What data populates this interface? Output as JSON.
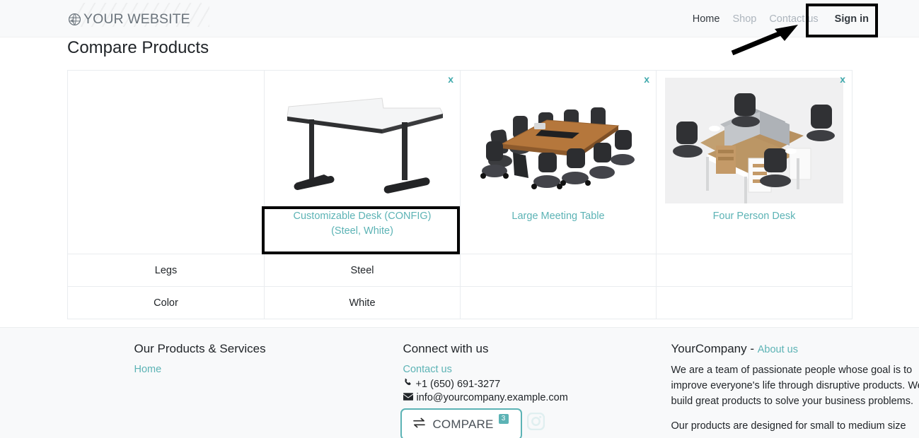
{
  "header": {
    "brand": "YOUR WEBSITE",
    "brand_icon": "globe-icon",
    "nav": [
      {
        "label": "Home",
        "active": true
      },
      {
        "label": "Shop",
        "active": false
      },
      {
        "label": "Contact us",
        "active": false
      }
    ],
    "signin_label": "Sign in"
  },
  "page": {
    "title": "Compare Products"
  },
  "compare": {
    "close_label": "x",
    "products": [
      {
        "name": "Customizable Desk (CONFIG) (Steel, White)",
        "image": "white-corner-desk-black-legs",
        "highlighted": true
      },
      {
        "name": "Large Meeting Table",
        "image": "wood-conference-table-with-chairs",
        "highlighted": false
      },
      {
        "name": "Four Person Desk",
        "image": "four-person-cubicle-workstation",
        "highlighted": false
      }
    ],
    "attributes": [
      {
        "name": "Legs",
        "values": [
          "Steel",
          "",
          ""
        ]
      },
      {
        "name": "Color",
        "values": [
          "White",
          "",
          ""
        ]
      }
    ]
  },
  "footer": {
    "col1": {
      "title": "Our Products & Services",
      "links": [
        "Home"
      ]
    },
    "col2": {
      "title": "Connect with us",
      "contact_link": "Contact us",
      "phone": "+1 (650) 691-3277",
      "email": "info@yourcompany.example.com",
      "phone_icon": "phone-icon",
      "email_icon": "envelope-icon",
      "social": [
        {
          "name": "facebook-icon",
          "faded": false
        },
        {
          "name": "twitter-icon",
          "faded": false
        },
        {
          "name": "linkedin-icon",
          "faded": false
        },
        {
          "name": "youtube-icon",
          "faded": true
        },
        {
          "name": "github-icon",
          "faded": true
        },
        {
          "name": "instagram-icon",
          "faded": true
        }
      ]
    },
    "col3": {
      "company": "YourCompany",
      "dash": "-",
      "about_link": "About us",
      "paragraph1": "We are a team of passionate people whose goal is to improve everyone's life through disruptive products. We build great products to solve your business problems.",
      "paragraph2": "Our products are designed for small to medium size"
    }
  },
  "compare_widget": {
    "icon": "compare-arrows-icon",
    "label": "COMPARE",
    "count": "3"
  },
  "colors": {
    "accent_teal": "#5cb3b5",
    "header_bg": "#f8f9fa",
    "footer_bg": "#f8f9fa",
    "text": "#212529",
    "muted": "#adb5bd",
    "annotation": "#000000"
  }
}
